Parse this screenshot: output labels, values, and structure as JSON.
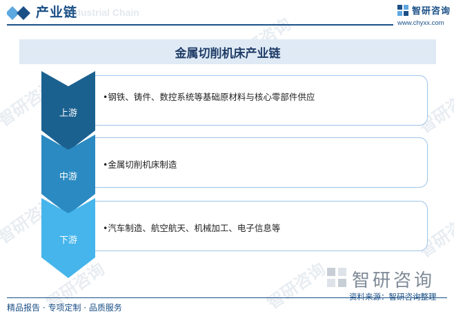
{
  "header": {
    "title": "产业链",
    "subtitle_watermark": "Industrial Chain",
    "logo_text": "智研咨询",
    "url": "www.chyxx.com"
  },
  "diagram": {
    "title": "金属切削机床产业链",
    "stages": [
      {
        "label": "上游",
        "text": "•钢铁、铸件、数控系统等基础原材料与核心零部件供应",
        "color": "#1b6190"
      },
      {
        "label": "中游",
        "text": "•金属切削机床制造",
        "color": "#2b8ac2"
      },
      {
        "label": "下游",
        "text": "•汽车制造、航空航天、机械加工、电子信息等",
        "color": "#45b5ec"
      }
    ]
  },
  "watermark": {
    "text": "智研咨询"
  },
  "footer": {
    "logo_text": "智研咨询",
    "left_text": "精品报告 · 专项定制 · 品质服务",
    "source": "资料来源：智研咨询整理"
  }
}
